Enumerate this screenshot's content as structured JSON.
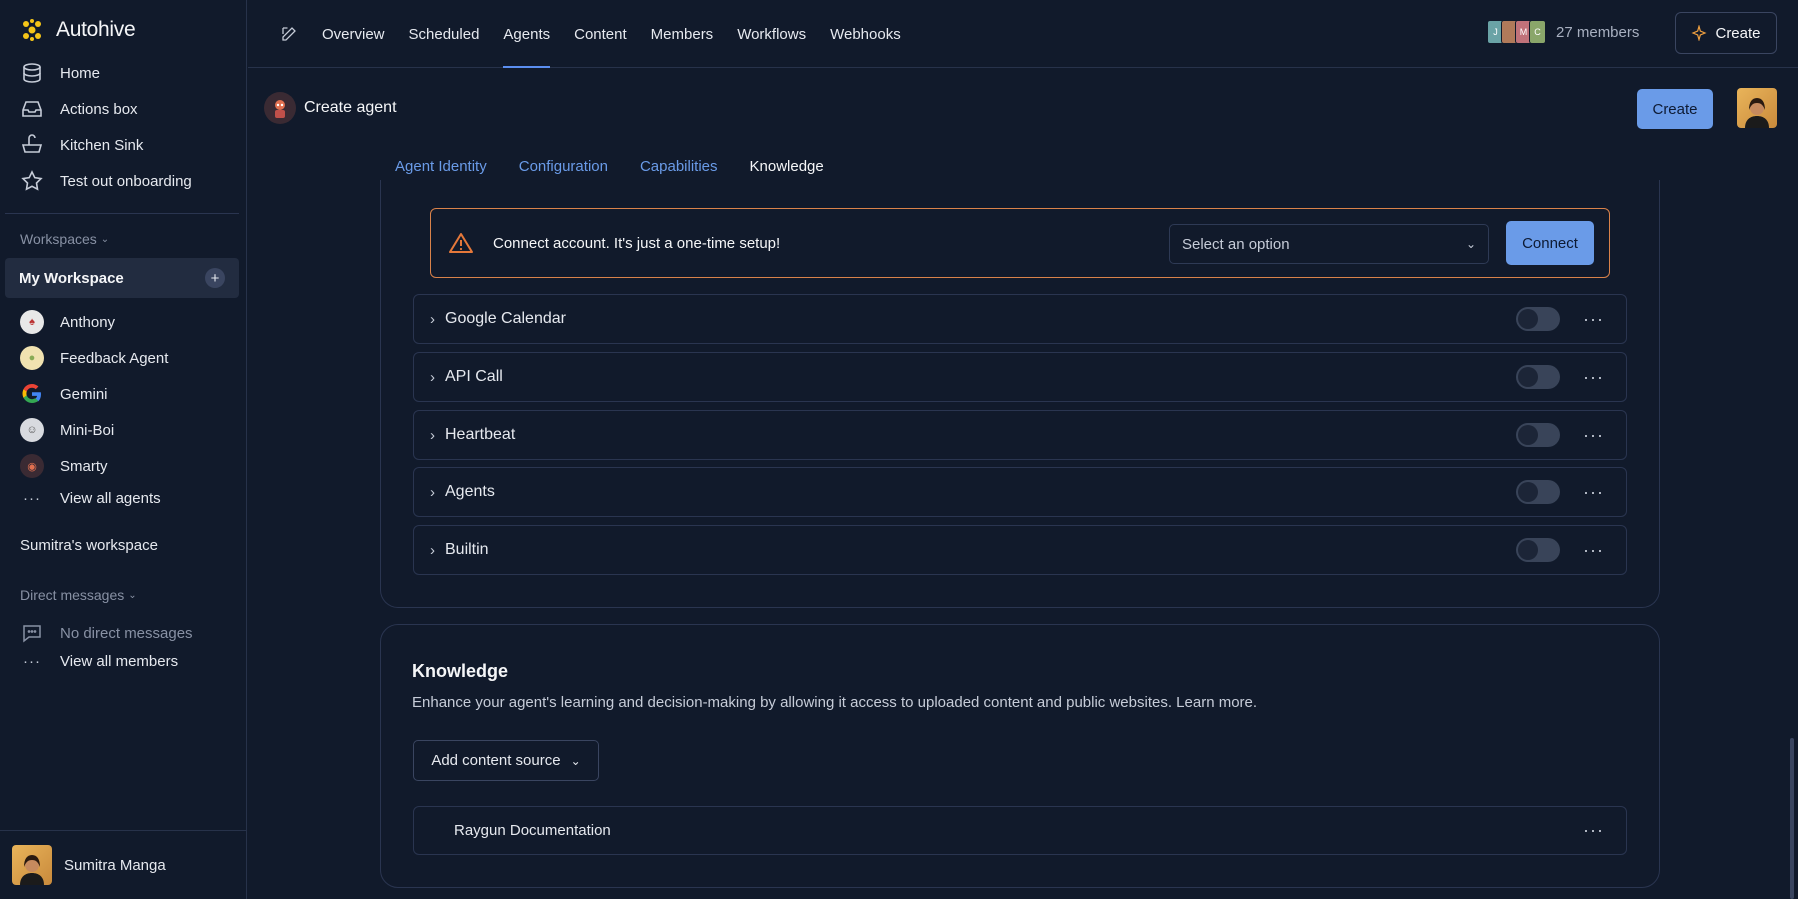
{
  "app": {
    "name": "Autohive"
  },
  "sidebar": {
    "nav": [
      {
        "label": "Home",
        "icon": "database-icon"
      },
      {
        "label": "Actions box",
        "icon": "inbox-icon"
      },
      {
        "label": "Kitchen Sink",
        "icon": "sink-icon"
      },
      {
        "label": "Test out onboarding",
        "icon": "star-icon"
      }
    ],
    "workspaces_heading": "Workspaces",
    "active_workspace": "My Workspace",
    "agents": [
      {
        "label": "Anthony"
      },
      {
        "label": "Feedback Agent"
      },
      {
        "label": "Gemini"
      },
      {
        "label": "Mini-Boi"
      },
      {
        "label": "Smarty"
      }
    ],
    "view_all_agents": "View all agents",
    "other_workspace": "Sumitra's workspace",
    "dm_heading": "Direct messages",
    "no_dm": "No direct messages",
    "view_all_members": "View all members",
    "user_name": "Sumitra Manga"
  },
  "topbar": {
    "tabs": [
      "Overview",
      "Scheduled",
      "Agents",
      "Content",
      "Members",
      "Workflows",
      "Webhooks"
    ],
    "active_tab": "Agents",
    "member_initials": [
      "J",
      "",
      "M",
      "C"
    ],
    "members_label": "27 members",
    "create_label": "Create"
  },
  "page": {
    "title": "Create agent",
    "create_button": "Create",
    "content_tabs": [
      "Agent Identity",
      "Configuration",
      "Capabilities",
      "Knowledge"
    ],
    "active_content_tab": "Knowledge"
  },
  "connect": {
    "message": "Connect account. It's just a one-time setup!",
    "select_placeholder": "Select an option",
    "connect_label": "Connect"
  },
  "tools": [
    {
      "label": "Google Calendar",
      "enabled": false
    },
    {
      "label": "API Call",
      "enabled": false
    },
    {
      "label": "Heartbeat",
      "enabled": false
    },
    {
      "label": "Agents",
      "enabled": false
    },
    {
      "label": "Builtin",
      "enabled": false
    }
  ],
  "knowledge": {
    "title": "Knowledge",
    "description": "Enhance your agent's learning and decision-making by allowing it access to uploaded content and public websites. Learn more.",
    "add_source_label": "Add content source",
    "sources": [
      {
        "label": "Raygun Documentation"
      }
    ]
  }
}
